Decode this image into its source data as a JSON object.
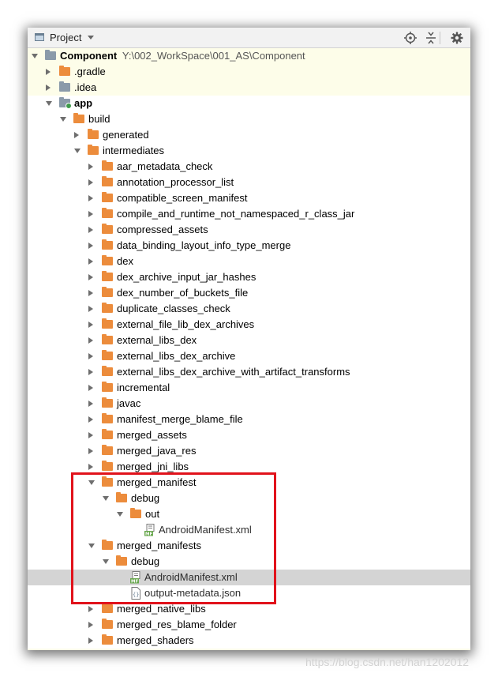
{
  "toolbar": {
    "title": "Project",
    "buttons": [
      "locate-icon",
      "collapse-all-icon",
      "gear-icon"
    ]
  },
  "tree": {
    "root": {
      "name": "Component",
      "path": "Y:\\002_WorkSpace\\001_AS\\Component"
    },
    "items": [
      {
        "label": "Component",
        "path": "Y:\\002_WorkSpace\\001_AS\\Component",
        "depth": 0,
        "expanded": true,
        "icon": "project-module"
      },
      {
        "label": ".gradle",
        "depth": 1,
        "expanded": false,
        "icon": "folder-orange"
      },
      {
        "label": ".idea",
        "depth": 1,
        "expanded": false,
        "icon": "folder-grey"
      },
      {
        "label": "app",
        "depth": 1,
        "expanded": true,
        "icon": "module"
      },
      {
        "label": "build",
        "depth": 2,
        "expanded": true,
        "icon": "folder-orange"
      },
      {
        "label": "generated",
        "depth": 3,
        "expanded": false,
        "icon": "folder-orange"
      },
      {
        "label": "intermediates",
        "depth": 3,
        "expanded": true,
        "icon": "folder-orange"
      },
      {
        "label": "aar_metadata_check",
        "depth": 4,
        "expanded": false,
        "icon": "folder-orange"
      },
      {
        "label": "annotation_processor_list",
        "depth": 4,
        "expanded": false,
        "icon": "folder-orange"
      },
      {
        "label": "compatible_screen_manifest",
        "depth": 4,
        "expanded": false,
        "icon": "folder-orange"
      },
      {
        "label": "compile_and_runtime_not_namespaced_r_class_jar",
        "depth": 4,
        "expanded": false,
        "icon": "folder-orange"
      },
      {
        "label": "compressed_assets",
        "depth": 4,
        "expanded": false,
        "icon": "folder-orange"
      },
      {
        "label": "data_binding_layout_info_type_merge",
        "depth": 4,
        "expanded": false,
        "icon": "folder-orange"
      },
      {
        "label": "dex",
        "depth": 4,
        "expanded": false,
        "icon": "folder-orange"
      },
      {
        "label": "dex_archive_input_jar_hashes",
        "depth": 4,
        "expanded": false,
        "icon": "folder-orange"
      },
      {
        "label": "dex_number_of_buckets_file",
        "depth": 4,
        "expanded": false,
        "icon": "folder-orange"
      },
      {
        "label": "duplicate_classes_check",
        "depth": 4,
        "expanded": false,
        "icon": "folder-orange"
      },
      {
        "label": "external_file_lib_dex_archives",
        "depth": 4,
        "expanded": false,
        "icon": "folder-orange"
      },
      {
        "label": "external_libs_dex",
        "depth": 4,
        "expanded": false,
        "icon": "folder-orange"
      },
      {
        "label": "external_libs_dex_archive",
        "depth": 4,
        "expanded": false,
        "icon": "folder-orange"
      },
      {
        "label": "external_libs_dex_archive_with_artifact_transforms",
        "depth": 4,
        "expanded": false,
        "icon": "folder-orange"
      },
      {
        "label": "incremental",
        "depth": 4,
        "expanded": false,
        "icon": "folder-orange"
      },
      {
        "label": "javac",
        "depth": 4,
        "expanded": false,
        "icon": "folder-orange"
      },
      {
        "label": "manifest_merge_blame_file",
        "depth": 4,
        "expanded": false,
        "icon": "folder-orange"
      },
      {
        "label": "merged_assets",
        "depth": 4,
        "expanded": false,
        "icon": "folder-orange"
      },
      {
        "label": "merged_java_res",
        "depth": 4,
        "expanded": false,
        "icon": "folder-orange"
      },
      {
        "label": "merged_jni_libs",
        "depth": 4,
        "expanded": false,
        "icon": "folder-orange"
      },
      {
        "label": "merged_manifest",
        "depth": 4,
        "expanded": true,
        "icon": "folder-orange"
      },
      {
        "label": "debug",
        "depth": 5,
        "expanded": true,
        "icon": "folder-orange"
      },
      {
        "label": "out",
        "depth": 6,
        "expanded": true,
        "icon": "folder-orange"
      },
      {
        "label": "AndroidManifest.xml",
        "depth": 7,
        "leaf": true,
        "icon": "manifest-file"
      },
      {
        "label": "merged_manifests",
        "depth": 4,
        "expanded": true,
        "icon": "folder-orange"
      },
      {
        "label": "debug",
        "depth": 5,
        "expanded": true,
        "icon": "folder-orange"
      },
      {
        "label": "AndroidManifest.xml",
        "depth": 6,
        "leaf": true,
        "icon": "manifest-file",
        "selected": true
      },
      {
        "label": "output-metadata.json",
        "depth": 6,
        "leaf": true,
        "icon": "json-file"
      },
      {
        "label": "merged_native_libs",
        "depth": 4,
        "expanded": false,
        "icon": "folder-orange"
      },
      {
        "label": "merged_res_blame_folder",
        "depth": 4,
        "expanded": false,
        "icon": "folder-orange"
      },
      {
        "label": "merged_shaders",
        "depth": 4,
        "expanded": false,
        "icon": "folder-orange"
      }
    ]
  },
  "colors": {
    "panel_background": "#fdfde9",
    "folder": "#ec8c3c",
    "selection": "#d4d4d4",
    "highlight_box": "#e1121b"
  },
  "watermark": "https://blog.csdn.net/han1202012"
}
